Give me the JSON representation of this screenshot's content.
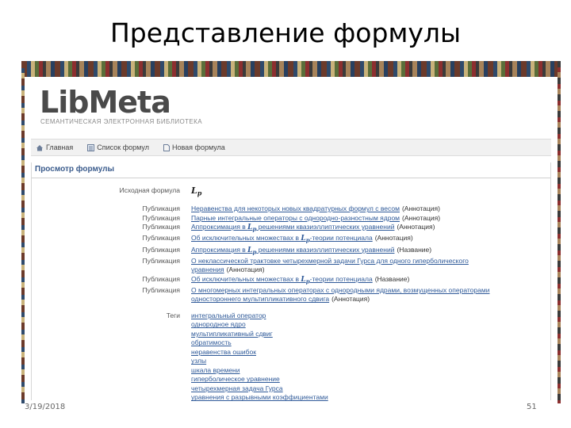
{
  "slide": {
    "title": "Представление формулы",
    "date": "3/19/2018",
    "page": "51"
  },
  "site": {
    "logo": "LibMeta",
    "subtitle": "СЕМАНТИЧЕСКАЯ ЭЛЕКТРОННАЯ БИБЛИОТЕКА"
  },
  "nav": {
    "items": [
      {
        "label": "Главная",
        "icon": "home-icon"
      },
      {
        "label": "Список формул",
        "icon": "list-icon"
      },
      {
        "label": "Новая формула",
        "icon": "document-icon"
      }
    ]
  },
  "panel": {
    "title": "Просмотр формулы",
    "formula_label": "Исходная формула",
    "formula_value": "L",
    "formula_sub": "p",
    "publication_label": "Публикация",
    "lp": "L",
    "lp_sub": "p",
    "publications": [
      {
        "pre": "Неравенства для некоторых новых квадратурных формул с весом",
        "post": "",
        "lp": false,
        "note": "(Аннотация)"
      },
      {
        "pre": "Парные интегральные операторы с однородно-разностным ядром",
        "post": "",
        "lp": false,
        "note": "(Аннотация)"
      },
      {
        "pre": "Аппроксимация в ",
        "post": " решениями квазиэллиптических уравнений",
        "lp": true,
        "note": "(Аннотация)"
      },
      {
        "pre": "Об исключительных множествах в ",
        "post": "-теории потенциала",
        "lp": true,
        "note": "(Аннотация)"
      },
      {
        "pre": "Аппроксимация в ",
        "post": " решениями квазиэллиптических уравнений",
        "lp": true,
        "note": "(Название)"
      },
      {
        "pre": "О неклассической трактовке четырехмерной задачи Гурса для одного гиперболического уравнения",
        "post": "",
        "lp": false,
        "note": "(Аннотация)"
      },
      {
        "pre": "Об исключительных множествах в ",
        "post": "-теории потенциала",
        "lp": true,
        "note": "(Название)"
      },
      {
        "pre": "О многомерных интегральных операторах с однородными ядрами, возмущенных операторами одностороннего мультипликативного сдвига",
        "post": "",
        "lp": false,
        "note": "(Аннотация)"
      }
    ],
    "tags_label": "Теги",
    "tags": [
      "интегральный оператор",
      "однородное ядро",
      "мультипликативный сдвиг",
      "обратимость",
      "неравенства ошибок",
      "узлы",
      "шкала времени",
      "гиперболическое уравнение",
      "четырехмерная задача Гурса",
      "уравнения с разрывными коэффициентами"
    ]
  }
}
